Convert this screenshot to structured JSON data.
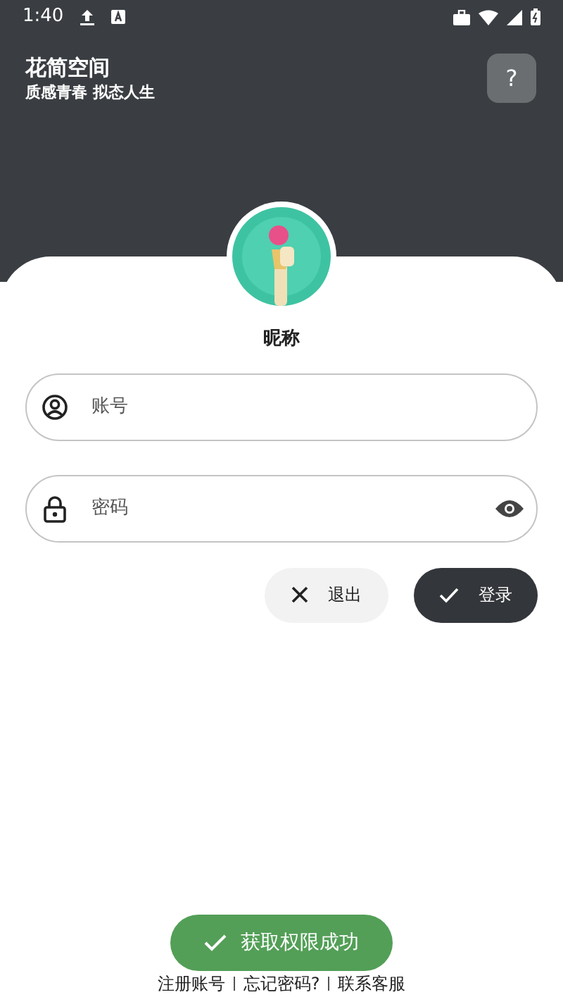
{
  "status_bar": {
    "time": "1:40"
  },
  "header": {
    "title": "花简空间",
    "subtitle": "质感青春 拟态人生",
    "help_button": "?"
  },
  "profile": {
    "nickname": "昵称"
  },
  "fields": [
    {
      "kind": "account",
      "placeholder": "账号"
    },
    {
      "kind": "password",
      "placeholder": "密码"
    }
  ],
  "buttons": [
    {
      "kind": "secondary",
      "label": "退出"
    },
    {
      "kind": "primary",
      "label": "登录"
    }
  ],
  "links": [
    "注册账号",
    "忘记密码?",
    "联系客服"
  ],
  "toast": {
    "text": "获取权限成功"
  }
}
